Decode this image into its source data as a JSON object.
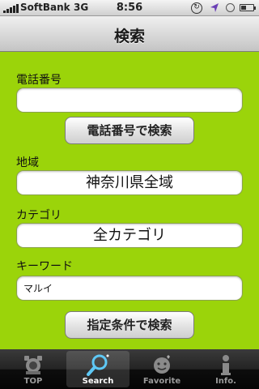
{
  "status": {
    "carrier": "SoftBank",
    "network": "3G",
    "time": "8:56"
  },
  "nav": {
    "title": "検索"
  },
  "form": {
    "phone_label": "電話番号",
    "phone_value": "",
    "phone_button": "電話番号で検索",
    "area_label": "地域",
    "area_value": "神奈川県全域",
    "category_label": "カテゴリ",
    "category_value": "全カテゴリ",
    "keyword_label": "キーワード",
    "keyword_value": "マルイ",
    "search_button": "指定条件で検索"
  },
  "tabs": [
    {
      "label": "TOP",
      "icon": "top-icon",
      "active": false
    },
    {
      "label": "Search",
      "icon": "magnifier-icon",
      "active": true
    },
    {
      "label": "Favorite",
      "icon": "favorite-icon",
      "active": false
    },
    {
      "label": "Info.",
      "icon": "info-icon",
      "active": false
    }
  ],
  "colors": {
    "background": "#9bd40a"
  }
}
